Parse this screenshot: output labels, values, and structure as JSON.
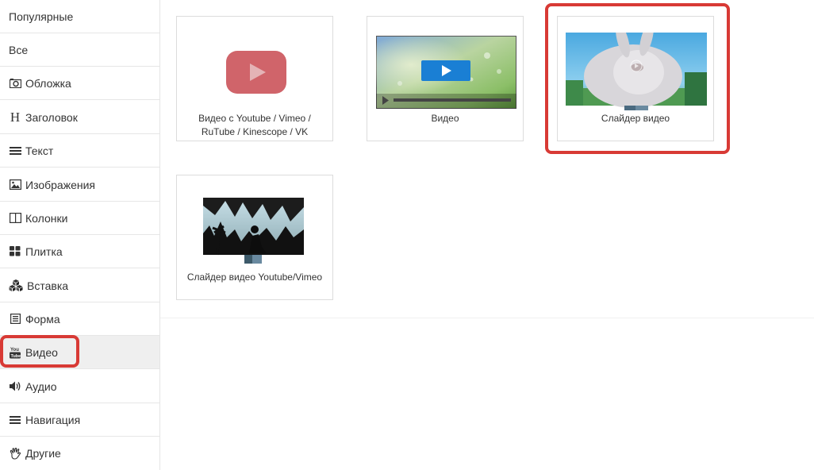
{
  "sidebar": {
    "items": [
      {
        "label": "Популярные",
        "icon": ""
      },
      {
        "label": "Все",
        "icon": ""
      },
      {
        "label": "Обложка",
        "icon": "camera-icon"
      },
      {
        "label": "Заголовок",
        "icon": "heading-icon"
      },
      {
        "label": "Текст",
        "icon": "lines-icon"
      },
      {
        "label": "Изображения",
        "icon": "image-icon"
      },
      {
        "label": "Колонки",
        "icon": "columns-icon"
      },
      {
        "label": "Плитка",
        "icon": "tiles-icon"
      },
      {
        "label": "Вставка",
        "icon": "cubes-icon"
      },
      {
        "label": "Форма",
        "icon": "form-icon"
      },
      {
        "label": "Видео",
        "icon": "youtube-icon",
        "active": true
      },
      {
        "label": "Аудио",
        "icon": "volume-icon"
      },
      {
        "label": "Навигация",
        "icon": "menu-icon"
      },
      {
        "label": "Другие",
        "icon": "hand-icon"
      }
    ]
  },
  "cards": [
    {
      "label": "Видео с Youtube / Vimeo / RuTube / Kinescope / VK"
    },
    {
      "label": "Видео"
    },
    {
      "label": "Слайдер видео"
    },
    {
      "label": "Слайдер видео Youtube/Vimeo"
    }
  ],
  "colors": {
    "highlight": "#d83a35",
    "youtube_red": "#d0646a",
    "play_blue": "#1a7fd4",
    "active_bg": "#efefef"
  }
}
